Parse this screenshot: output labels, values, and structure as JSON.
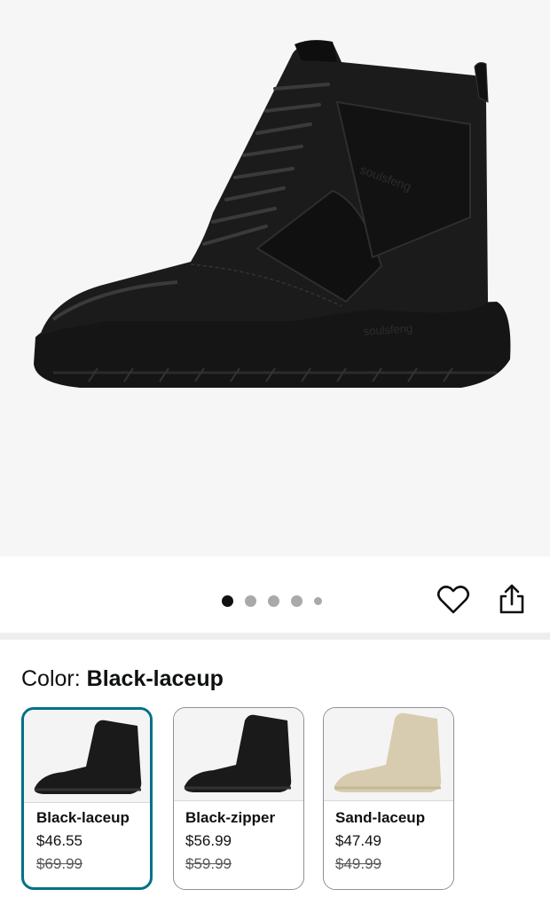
{
  "product": {
    "image_alt": "soulsfeng",
    "brand_text": "soulsfeng"
  },
  "gallery": {
    "total_images": 5,
    "active_index": 0
  },
  "actions": {
    "wishlist_icon": "heart-outline-icon",
    "share_icon": "share-icon"
  },
  "color": {
    "label": "Color: ",
    "selected_value": "Black-laceup"
  },
  "variants": [
    {
      "name": "Black-laceup",
      "price": "$46.55",
      "list_price": "$69.99",
      "selected": true,
      "shoe_color": "#1a1a1a"
    },
    {
      "name": "Black-zipper",
      "price": "$56.99",
      "list_price": "$59.99",
      "selected": false,
      "shoe_color": "#1a1a1a"
    },
    {
      "name": "Sand-laceup",
      "price": "$47.49",
      "list_price": "$49.99",
      "selected": false,
      "shoe_color": "#d8ccb0"
    }
  ],
  "colors": {
    "selected_border": "#007185",
    "dot_active": "#0f1111",
    "dot_inactive": "#a9a9a9"
  }
}
